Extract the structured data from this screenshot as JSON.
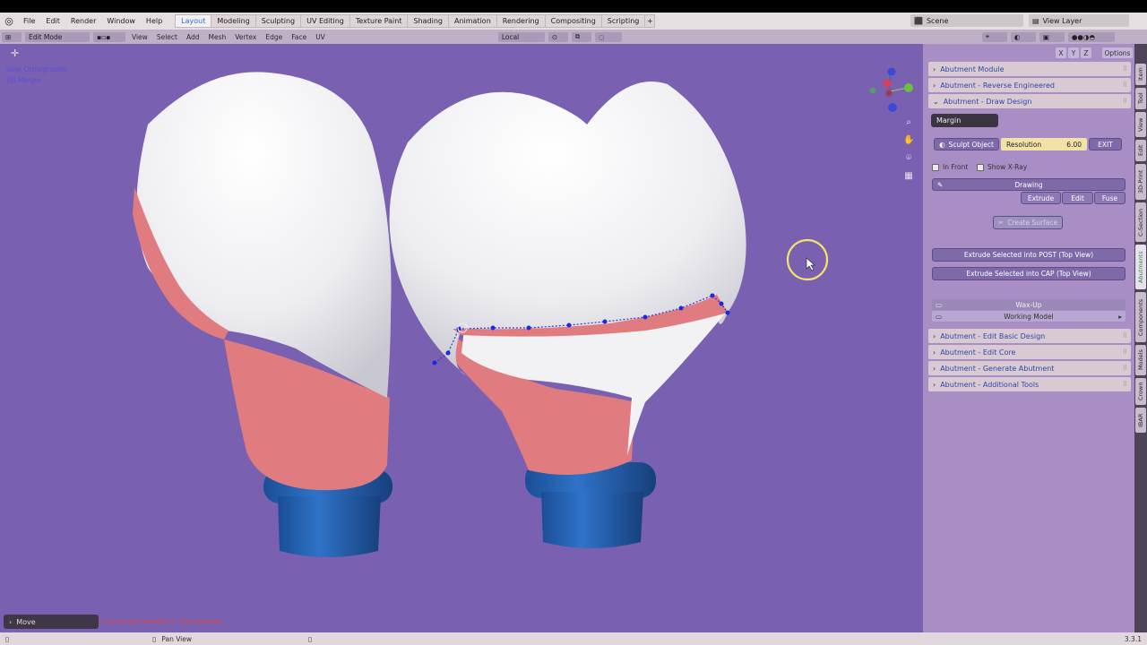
{
  "menu": {
    "items": [
      "File",
      "Edit",
      "Render",
      "Window",
      "Help"
    ]
  },
  "workspaces": [
    "Layout",
    "Modeling",
    "Sculpting",
    "UV Editing",
    "Texture Paint",
    "Shading",
    "Animation",
    "Rendering",
    "Compositing",
    "Scripting"
  ],
  "scene": {
    "label": "Scene",
    "view_layer": "View Layer"
  },
  "header": {
    "mode": "Edit Mode",
    "menus": [
      "View",
      "Select",
      "Add",
      "Mesh",
      "Vertex",
      "Edge",
      "Face",
      "UV"
    ],
    "transform_orientation": "Local",
    "options": "Options"
  },
  "viewport": {
    "view_name": "User Orthographic",
    "object_name": "(0) Margin",
    "colors": {
      "background": "#7960b0",
      "tooth": "#f2f2f4",
      "margin": "#e07c80",
      "implant": "#1f5fae"
    }
  },
  "operator_panel": {
    "label": "Move"
  },
  "hint_text": "(1) draw and readable 2. Then proceed",
  "npanel": {
    "axes": [
      "X",
      "Y",
      "Z"
    ],
    "panels_top": [
      {
        "label": "Abutment Module",
        "expanded": false
      },
      {
        "label": "Abutment - Reverse Engineered",
        "expanded": false
      },
      {
        "label": "Abutment - Draw Design",
        "expanded": true
      }
    ],
    "draw_design": {
      "object_field": "Margin",
      "sculpt_object": "Sculpt Object",
      "resolution_label": "Resolution",
      "resolution_value": "6.00",
      "exit": "EXIT",
      "in_front": "In Front",
      "show_xray": "Show X-Ray",
      "drawing": "Drawing",
      "extrude": "Extrude",
      "edit": "Edit",
      "fuse": "Fuse",
      "create_surface": "Create Surface",
      "extrude_post": "Extrude Selected into POST (Top View)",
      "extrude_cap": "Extrude Selected  into CAP (Top View)",
      "wax_up": "Wax-Up",
      "working_model": "Working Model"
    },
    "panels_bottom": [
      {
        "label": "Abutment - Edit Basic Design",
        "expanded": false
      },
      {
        "label": "Abutment - Edit Core",
        "expanded": false
      },
      {
        "label": "Abutment - Generate Abutment",
        "expanded": false
      },
      {
        "label": "Abutment - Additional Tools",
        "expanded": false
      }
    ]
  },
  "side_tabs": [
    "Item",
    "Tool",
    "View",
    "Edit",
    "3D-Print",
    "C-Section",
    "Abutments",
    "Components",
    "Models",
    "Crown",
    "IBAR"
  ],
  "status": {
    "pan_view": "Pan View",
    "version": "3.3.1"
  }
}
